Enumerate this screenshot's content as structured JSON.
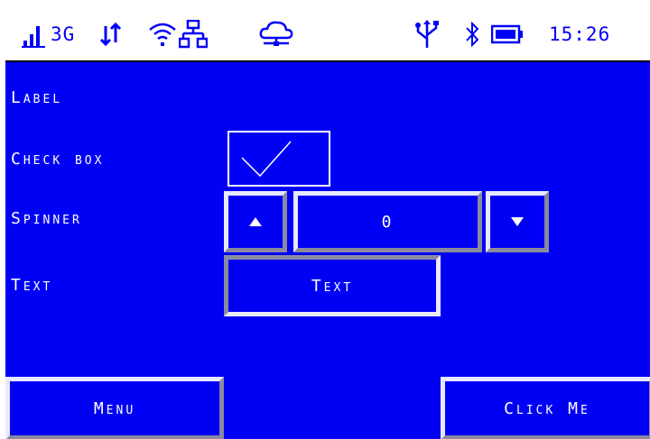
{
  "status_bar": {
    "network_type": "3G",
    "time": "15:26",
    "icons": [
      "signal-bars-icon",
      "data-transfer-icon",
      "wifi-icon",
      "ethernet-icon",
      "cloud-icon",
      "usb-icon",
      "bluetooth-icon",
      "battery-icon"
    ]
  },
  "form": {
    "label_text": "Label",
    "checkbox_label": "Check box",
    "checkbox_checked": true,
    "spinner_label": "Spinner",
    "spinner_value": "0",
    "text_label": "Text",
    "text_button_label": "Text"
  },
  "footer": {
    "menu_label": "Menu",
    "click_me_label": "Click Me"
  },
  "colors": {
    "screen_background": "#0000f5",
    "status_bar_background": "#ffffff",
    "text": "#ffffff",
    "bevel_light": "#e8e8ff",
    "bevel_dark": "#8a8a9e"
  }
}
